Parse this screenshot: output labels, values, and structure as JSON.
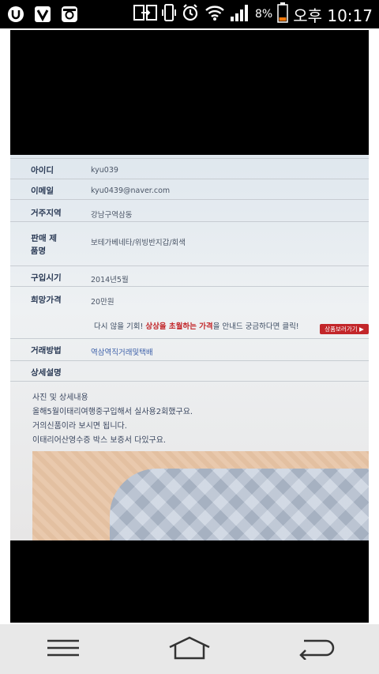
{
  "status_bar": {
    "battery_percent": "8%",
    "time": "오후 10:17",
    "icons": [
      "u-app-icon",
      "v-app-icon",
      "instagram-icon",
      "screen-share-icon",
      "phone-vibrate-icon",
      "alarm-icon",
      "wifi-icon",
      "signal-icon",
      "battery-icon"
    ]
  },
  "photo": {
    "rows": [
      {
        "label": "아이디",
        "value": "kyu039"
      },
      {
        "label": "이메일",
        "value": "kyu0439@naver.com"
      },
      {
        "label": "거주지역",
        "value": "강남구역삼동"
      },
      {
        "label": "판매 제\n품명",
        "value": "보테가베네타/위빙반지갑/회색"
      },
      {
        "label": "구입시기",
        "value": "2014년5월"
      },
      {
        "label": "희망가격",
        "value": "20만원"
      }
    ],
    "notice_pre": "다시 않을 기회!",
    "notice_red": "상상을 초월하는 가격",
    "notice_post": "을 안내드 궁금하다면 클릭!",
    "notice_button": "상품보러가기 ▶",
    "trade_label": "거래방법",
    "trade_value": "역삼역직거래및택배",
    "detail_label": "상세설명",
    "detail_lines": [
      "사진 및 상세내용",
      "올해5월이태리여행중구입해서 실사용2회했구요.",
      "거의신품이라 보시면 됩니다.",
      "이태리어산영수증 박스 보증서 다있구요."
    ]
  },
  "nav": {
    "buttons": [
      "menu-icon",
      "home-icon",
      "back-icon"
    ]
  }
}
